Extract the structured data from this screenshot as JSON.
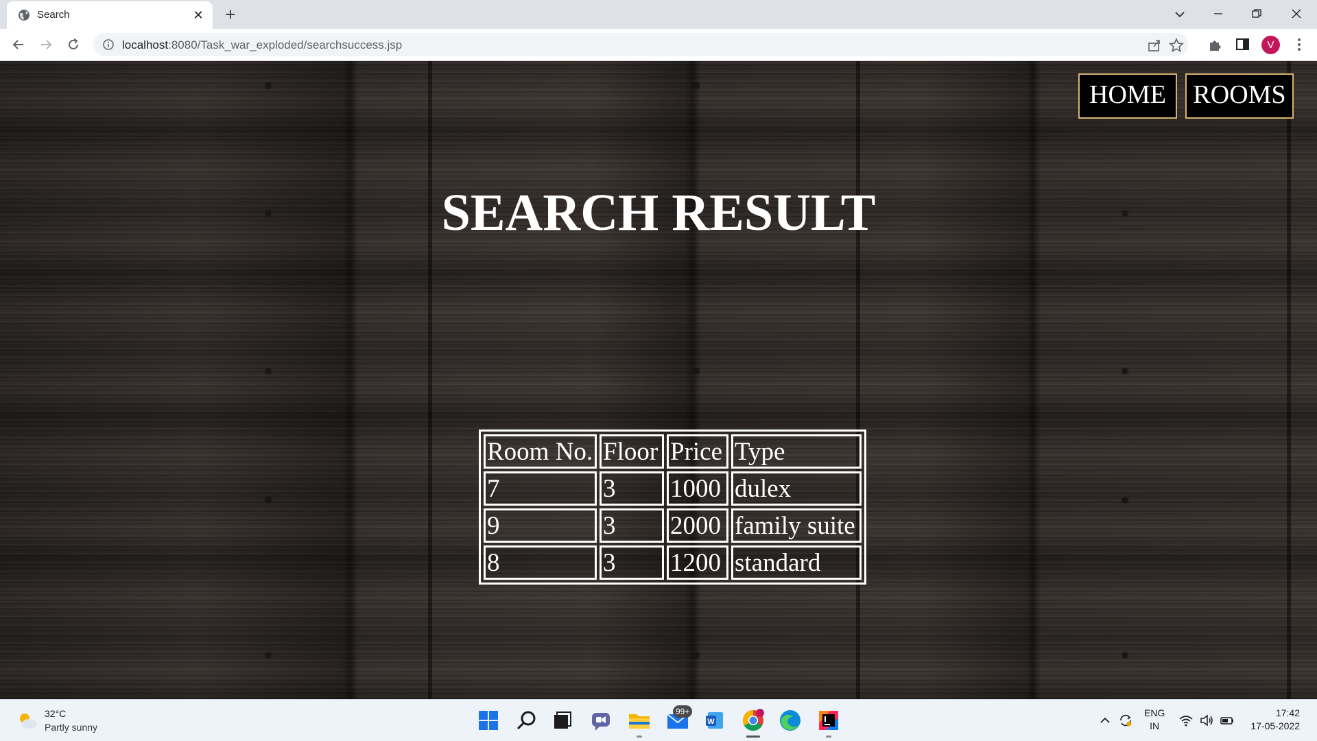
{
  "browser": {
    "tab_title": "Search",
    "url_host": "localhost",
    "url_rest": ":8080/Task_war_exploded/searchsuccess.jsp",
    "avatar_letter": "V"
  },
  "nav": {
    "home_label": "HOME",
    "rooms_label": "ROOMS"
  },
  "page": {
    "title": "SEARCH RESULT"
  },
  "results": {
    "columns": [
      "Room No.",
      "Floor",
      "Price",
      "Type"
    ],
    "rows": [
      [
        "7",
        "3",
        "1000",
        "dulex"
      ],
      [
        "9",
        "3",
        "2000",
        "family suite"
      ],
      [
        "8",
        "3",
        "1200",
        "standard"
      ]
    ]
  },
  "taskbar": {
    "weather_temp": "32°C",
    "weather_condition": "Partly sunny",
    "mail_badge": "99+",
    "language_line1": "ENG",
    "language_line2": "IN",
    "time": "17:42",
    "date": "17-05-2022"
  },
  "colors": {
    "nav_border": "#d9b26f",
    "avatar": "#c2185b"
  }
}
